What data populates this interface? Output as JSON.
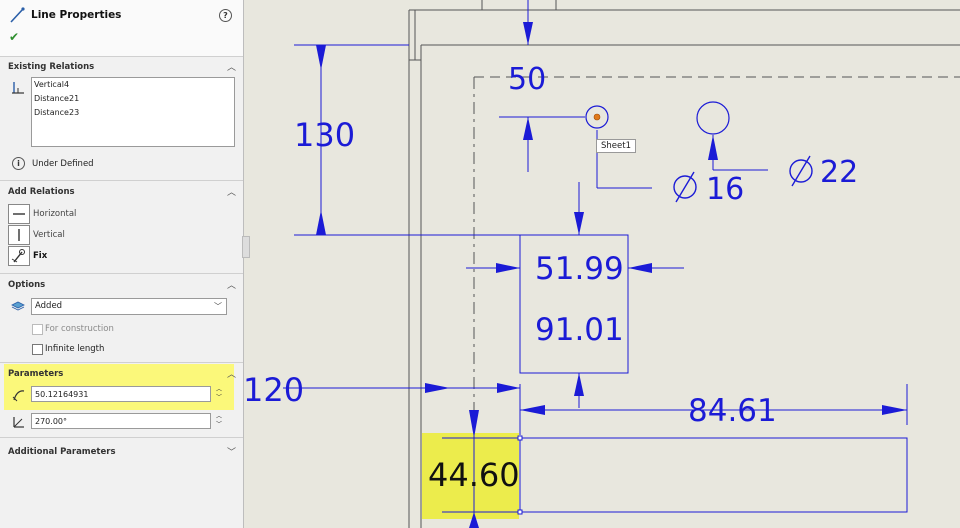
{
  "panel": {
    "title": "Line Properties",
    "help_icon": "?",
    "confirm_icon": "✔",
    "existing_relations": {
      "header": "Existing Relations",
      "items": [
        "Vertical4",
        "Distance21",
        "Distance23"
      ],
      "status": "Under Defined"
    },
    "add_relations": {
      "header": "Add Relations",
      "items": [
        "Horizontal",
        "Vertical",
        "Fix"
      ]
    },
    "options": {
      "header": "Options",
      "selected": "Added",
      "for_construction": "For construction",
      "infinite_length": "Infinite length"
    },
    "parameters": {
      "header": "Parameters",
      "length": "50.12164931",
      "angle": "270.00°"
    },
    "additional_parameters": {
      "header": "Additional Parameters"
    }
  },
  "drawing": {
    "dims": {
      "d50": "50",
      "d130": "130",
      "d16": "16",
      "d22": "22",
      "d5199": "51.99",
      "d9101": "91.01",
      "d120": "120",
      "d8461": "84.61",
      "d4460": "44.60"
    },
    "tooltip": "Sheet1"
  },
  "colors": {
    "dimension": "#1b1bd6",
    "highlight": "#fbf87a",
    "selected_dim": "#ecec4c",
    "check": "#2f8f2f"
  }
}
